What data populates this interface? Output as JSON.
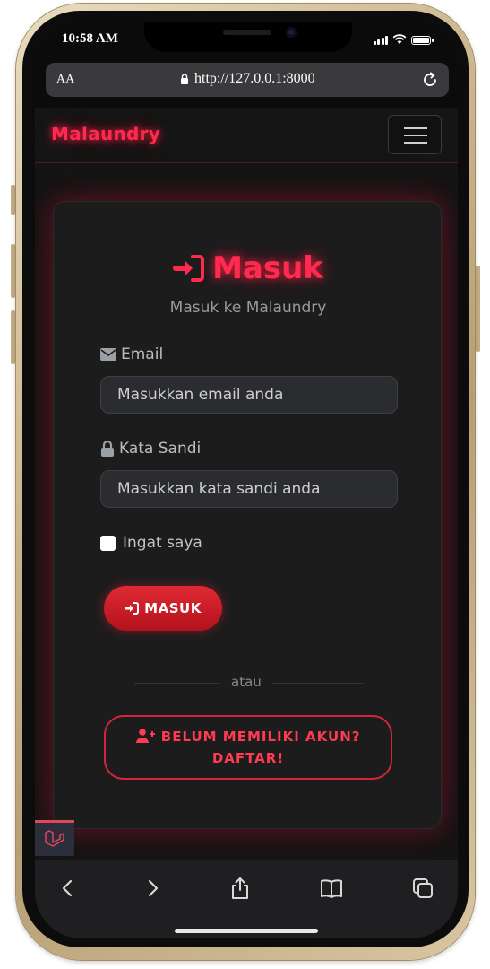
{
  "status_bar": {
    "time": "10:58 AM"
  },
  "browser": {
    "text_size_label": "AA",
    "url": "http://127.0.0.1:8000"
  },
  "navbar": {
    "brand": "Malaundry"
  },
  "login": {
    "title": "Masuk",
    "subtitle": "Masuk ke Malaundry",
    "email_label": "Email",
    "email_placeholder": "Masukkan email anda",
    "password_label": "Kata Sandi",
    "password_placeholder": "Masukkan kata sandi anda",
    "remember_label": "Ingat saya",
    "submit_label": "MASUK",
    "divider_text": "atau",
    "register_line1": "BELUM MEMILIKI AKUN?",
    "register_line2": "DAFTAR!"
  },
  "icons": {
    "login": "sign-in-icon",
    "email": "envelope-icon",
    "password": "lock-icon",
    "register": "user-plus-icon",
    "laravel": "laravel-logo-icon"
  },
  "colors": {
    "accent": "#ff2a4d",
    "button": "#d41f2c",
    "card_bg": "#1c1c1d",
    "page_bg": "#141414"
  }
}
